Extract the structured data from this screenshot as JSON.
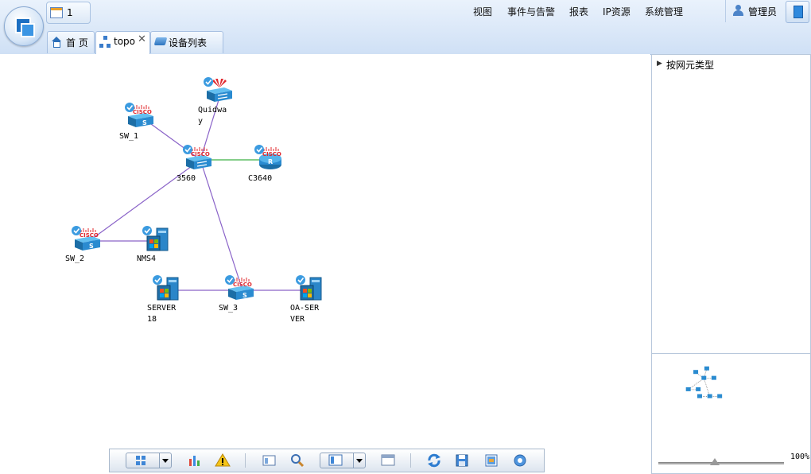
{
  "header": {
    "message_count": "1",
    "menu": [
      "视图",
      "事件与告警",
      "报表",
      "IP资源",
      "系统管理"
    ],
    "user": "管理员"
  },
  "tabs": [
    {
      "label": "首 页",
      "icon": "home-icon"
    },
    {
      "label": "topo",
      "icon": "topology-icon",
      "closable": true
    },
    {
      "label": "设备列表",
      "icon": "device-list-icon"
    }
  ],
  "topology": {
    "nodes": [
      {
        "id": "quidway",
        "label": "Quidwa\ny",
        "brand": "huawei",
        "kind": "switch"
      },
      {
        "id": "sw1",
        "label": "SW_1",
        "brand": "cisco",
        "kind": "switch-s"
      },
      {
        "id": "c3560",
        "label": "3560",
        "brand": "cisco",
        "kind": "switch"
      },
      {
        "id": "c3640",
        "label": "C3640",
        "brand": "cisco",
        "kind": "router"
      },
      {
        "id": "sw2",
        "label": "SW_2",
        "brand": "cisco",
        "kind": "switch-s"
      },
      {
        "id": "nms4",
        "label": "NMS4",
        "brand": "windows",
        "kind": "server"
      },
      {
        "id": "server18",
        "label": "SERVER\n18",
        "brand": "windows",
        "kind": "server"
      },
      {
        "id": "sw3",
        "label": "SW_3",
        "brand": "cisco",
        "kind": "switch-s"
      },
      {
        "id": "oaserver",
        "label": "OA-SER\nVER",
        "brand": "windows",
        "kind": "server"
      }
    ],
    "links": [
      {
        "from": "sw1",
        "to": "c3560",
        "color": "#8a63c8"
      },
      {
        "from": "quidway",
        "to": "c3560",
        "color": "#8a63c8"
      },
      {
        "from": "c3560",
        "to": "c3640",
        "color": "#3cb043"
      },
      {
        "from": "c3560",
        "to": "sw2",
        "color": "#8a63c8"
      },
      {
        "from": "c3560",
        "to": "sw3",
        "color": "#8a63c8"
      },
      {
        "from": "sw2",
        "to": "nms4",
        "color": "#8a63c8"
      },
      {
        "from": "server18",
        "to": "sw3",
        "color": "#8a63c8"
      },
      {
        "from": "sw3",
        "to": "oaserver",
        "color": "#8a63c8"
      }
    ]
  },
  "side_panel": {
    "title": "按网元类型"
  },
  "zoom": {
    "label": "100%",
    "level": 0.45
  },
  "toolbar": {
    "buttons": [
      "layout-icon",
      "chart-icon",
      "warning-icon",
      "panel-icon",
      "search-icon",
      "view-icon",
      "window-icon",
      "refresh-icon",
      "save-icon",
      "export-icon",
      "settings-icon"
    ]
  }
}
